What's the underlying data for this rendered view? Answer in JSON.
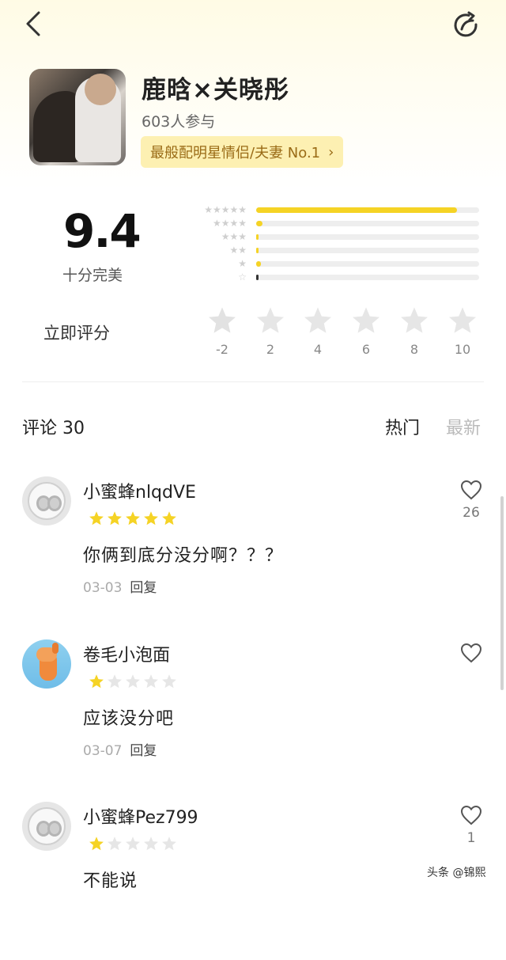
{
  "topic": {
    "title": "鹿晗×关晓彤",
    "participants": "603人参与",
    "rank_badge": "最般配明星情侣/夫妻 No.1"
  },
  "rating": {
    "score": "9.4",
    "score_desc": "十分完美",
    "distribution": [
      {
        "stars": 5,
        "fraction": 0.9
      },
      {
        "stars": 4,
        "fraction": 0.03
      },
      {
        "stars": 3,
        "fraction": 0.01
      },
      {
        "stars": 2,
        "fraction": 0.01
      },
      {
        "stars": 1,
        "fraction": 0.02
      },
      {
        "stars": 0,
        "fraction": 0.01
      }
    ],
    "rate_label": "立即评分",
    "rate_values": [
      "-2",
      "2",
      "4",
      "6",
      "8",
      "10"
    ]
  },
  "comments_header": {
    "title": "评论 30",
    "sort_hot": "热门",
    "sort_new": "最新"
  },
  "comments": [
    {
      "username": "小蜜蜂nlqdVE",
      "stars": 5,
      "text": "你俩到底分没分啊？？？",
      "date": "03-03",
      "reply": "回复",
      "likes": "26",
      "avatar": "bee"
    },
    {
      "username": "卷毛小泡面",
      "stars": 1,
      "text": "应该没分吧",
      "date": "03-07",
      "reply": "回复",
      "likes": "",
      "avatar": "dog"
    },
    {
      "username": "小蜜蜂Pez799",
      "stars": 1,
      "text": "不能说",
      "date": "",
      "reply": "",
      "likes": "1",
      "avatar": "bee"
    }
  ],
  "watermark": "头条 @锦熙",
  "colors": {
    "accent": "#f5d325",
    "badge_bg": "#fdf0b2",
    "badge_text": "#9a6b16"
  }
}
